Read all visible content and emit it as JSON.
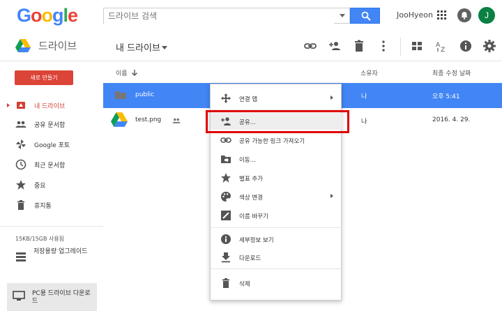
{
  "header": {
    "logo_letters": [
      {
        "ch": "G",
        "cls": "c1"
      },
      {
        "ch": "o",
        "cls": "c2"
      },
      {
        "ch": "o",
        "cls": "c3"
      },
      {
        "ch": "g",
        "cls": "c1"
      },
      {
        "ch": "l",
        "cls": "c4"
      },
      {
        "ch": "e",
        "cls": "c2"
      }
    ],
    "search_placeholder": "드라이브 검색",
    "user_name": "JooHyeon",
    "avatar_initial": "J"
  },
  "subbar": {
    "app_title": "드라이브",
    "location_title": "내 드라이브",
    "toolbar_icons": [
      "link-icon",
      "add-person-icon",
      "trash-icon",
      "more-vert-icon",
      "grid-view-icon",
      "sort-az-icon",
      "info-icon",
      "settings-icon"
    ]
  },
  "sidebar": {
    "new_button": "새로 만들기",
    "items": [
      {
        "label": "내 드라이브",
        "icon": "drive-icon",
        "active": true
      },
      {
        "label": "공유 문서함",
        "icon": "people-icon",
        "active": false
      },
      {
        "label": "Google 포토",
        "icon": "pinwheel-icon",
        "active": false
      },
      {
        "label": "최근 문서함",
        "icon": "clock-icon",
        "active": false
      },
      {
        "label": "중요",
        "icon": "star-icon",
        "active": false
      },
      {
        "label": "휴지통",
        "icon": "trash-icon",
        "active": false
      }
    ],
    "storage": "15KB/15GB 사용됨",
    "upgrade": "저장용량 업그레이드",
    "pc_drive": "PC용 드라이브 다운로드"
  },
  "list": {
    "columns": {
      "name": "이름",
      "owner": "소유자",
      "modified": "최종 수정 날짜"
    },
    "rows": [
      {
        "name": "public",
        "owner": "나",
        "modified": "오후 5:41",
        "selected": true
      },
      {
        "name": "test.png",
        "owner": "나",
        "modified": "2016. 4. 29.",
        "selected": false
      }
    ]
  },
  "context_menu": {
    "items": [
      {
        "label": "연결 앱",
        "icon": "move-arrows-icon",
        "submenu": true
      },
      {
        "label": "공유...",
        "icon": "add-person-icon",
        "submenu": false
      },
      {
        "label": "공유 가능한 링크 가져오기",
        "icon": "link-icon",
        "submenu": false
      },
      {
        "label": "이동...",
        "icon": "folder-move-icon",
        "submenu": false
      },
      {
        "label": "별표 추가",
        "icon": "star-icon",
        "submenu": false
      },
      {
        "label": "색상 변경",
        "icon": "palette-icon",
        "submenu": true
      },
      {
        "label": "이름 바꾸기",
        "icon": "rename-icon",
        "submenu": false
      },
      {
        "label": "세부정보 보기",
        "icon": "info-icon",
        "submenu": false
      },
      {
        "label": "다운로드",
        "icon": "download-icon",
        "submenu": false
      },
      {
        "label": "삭제",
        "icon": "trash-icon",
        "submenu": false
      }
    ]
  },
  "colors": {
    "accent_blue": "#4285f4",
    "new_button_red": "#db4437",
    "highlight_red": "#e00000"
  }
}
